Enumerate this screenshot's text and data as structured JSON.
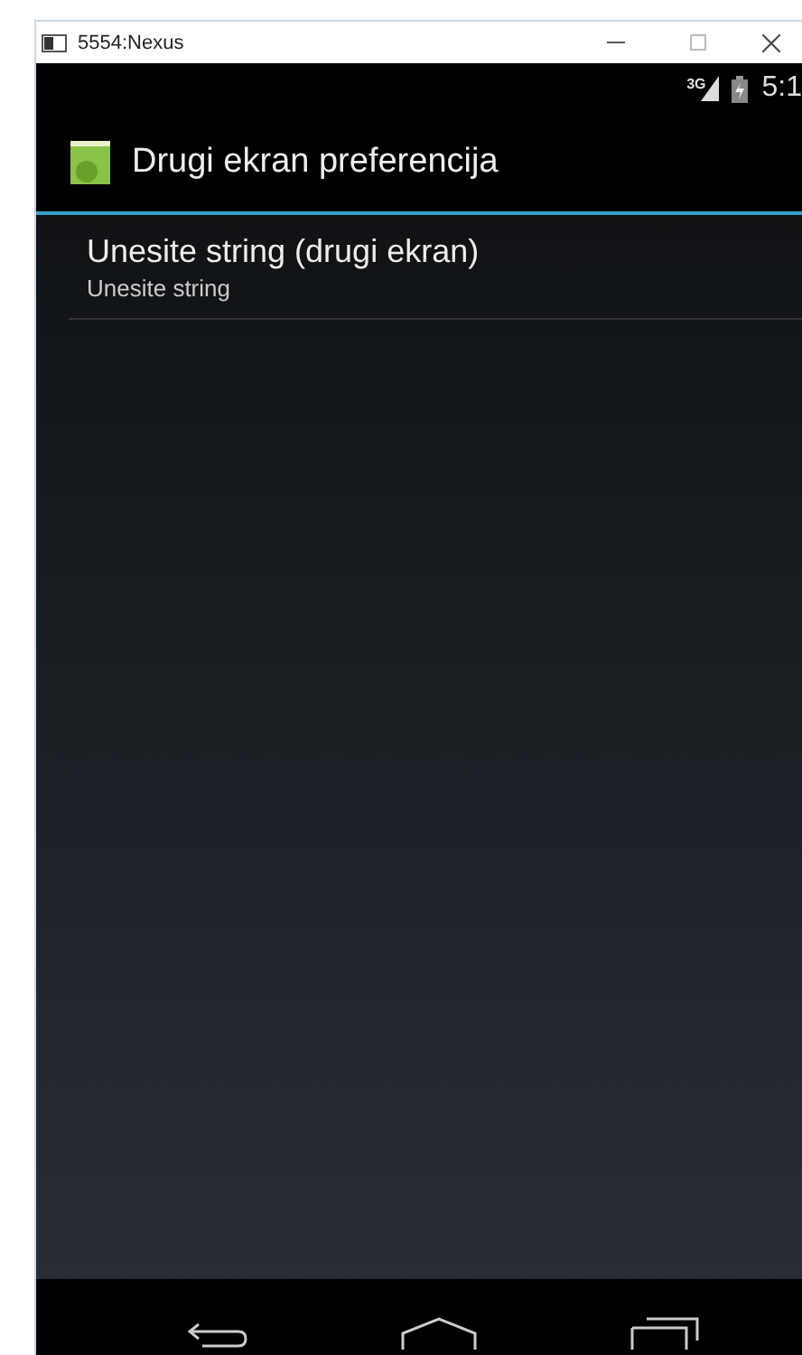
{
  "window": {
    "title": "5554:Nexus"
  },
  "status_bar": {
    "network": "3G",
    "time": "5:1"
  },
  "action_bar": {
    "title": "Drugi ekran preferencija"
  },
  "preferences": [
    {
      "title": "Unesite string (drugi ekran)",
      "summary": "Unesite string"
    }
  ]
}
